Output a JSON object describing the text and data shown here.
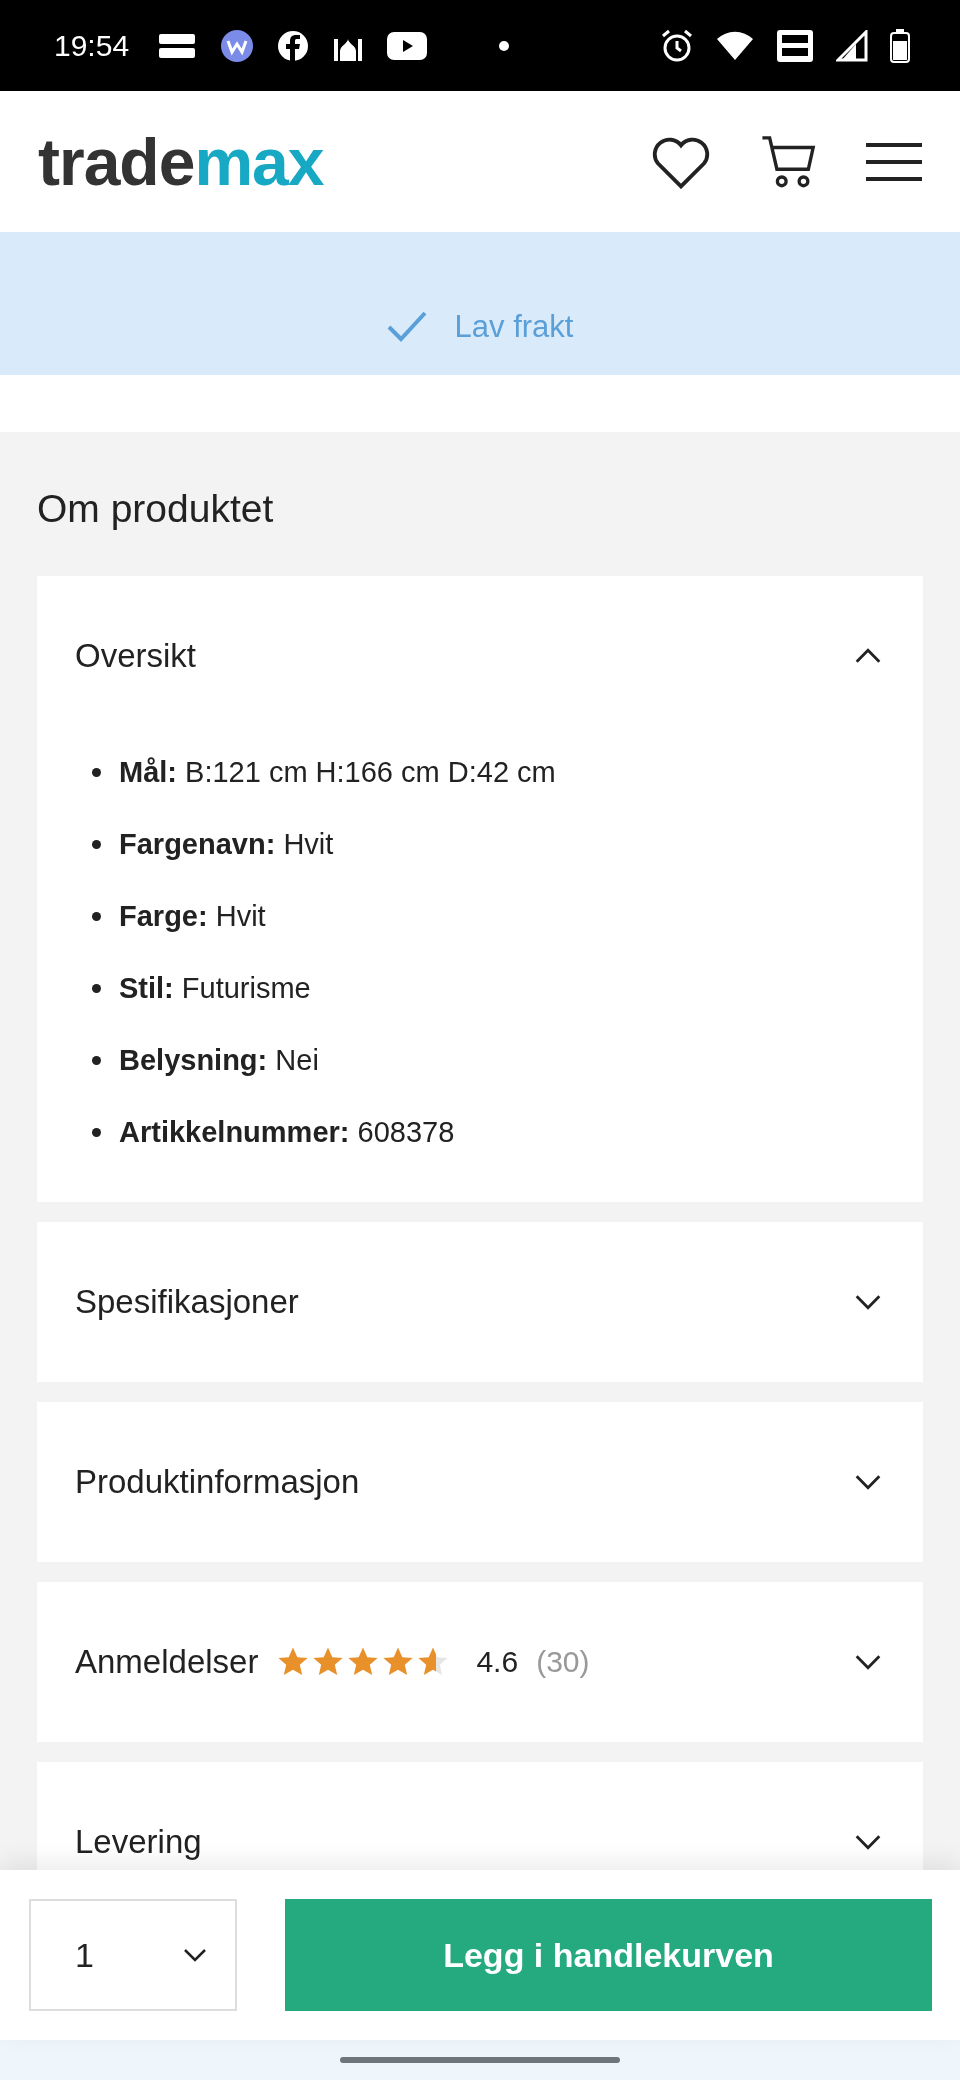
{
  "status_bar": {
    "time": "19:54"
  },
  "header": {
    "logo": {
      "part_1": "trade",
      "part_2": "max"
    }
  },
  "banner": {
    "items": [
      {
        "label": "Lav frakt"
      }
    ]
  },
  "section": {
    "title": "Om produktet",
    "accordions": [
      {
        "title": "Oversikt",
        "expanded": true,
        "specs": [
          "**Mål:** B:121 cm H:166 cm D:42 cm",
          "**Fargenavn:** Hvit",
          "**Farge:** Hvit",
          "**Stil:** Futurisme",
          "**Belysning:** Nei",
          "**Artikkelnummer:** 608378"
        ]
      },
      {
        "title": "Spesifikasjoner",
        "expanded": false
      },
      {
        "title": "Produktinformasjon",
        "expanded": false
      },
      {
        "title": "Anmeldelser",
        "expanded": false,
        "rating": {
          "stars": 4.6,
          "score": "4.6",
          "count": "(30)"
        }
      },
      {
        "title": "Levering",
        "expanded": false
      }
    ]
  },
  "bottom_bar": {
    "quantity": "1",
    "button": "Legg i handlekurven"
  }
}
